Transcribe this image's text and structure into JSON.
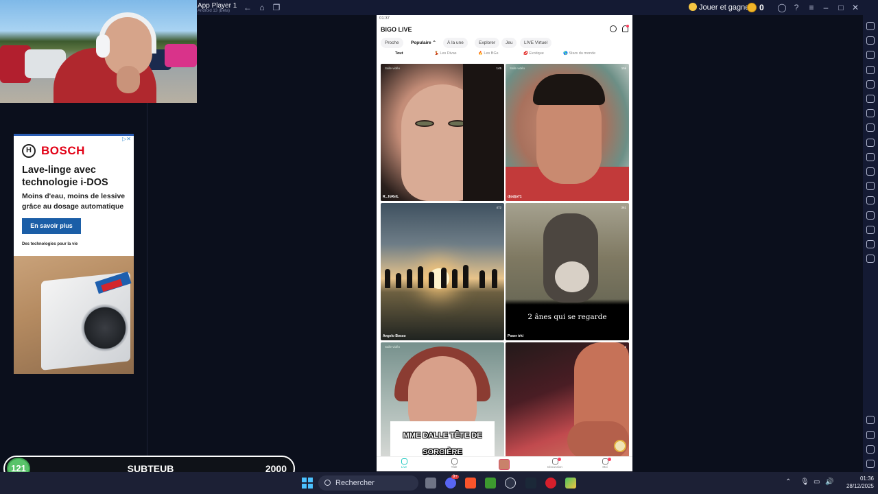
{
  "titlebar": {
    "app_title": "App Player 1",
    "app_subtitle": "Android 13 (Beta)",
    "jouer_label": "Jouer et gagner",
    "coin_count": "0"
  },
  "ad": {
    "brand": "BOSCH",
    "headline": "Lave-linge avec technologie i-DOS",
    "description": "Moins d'eau, moins de lessive grâce au dosage automatique",
    "cta": "En savoir plus",
    "tagline": "Des technologies pour la vie"
  },
  "sub_bar": {
    "level": "121",
    "name": "SUBTEUB",
    "goal": "2000"
  },
  "phone": {
    "status_time": "01:37",
    "brand": "BIGO LIVE",
    "tabs": [
      "Proche",
      "Populaire ⌃",
      "À la une",
      "Explorer",
      "Jeu",
      "LIVE Virtuel"
    ],
    "subtabs": [
      "Tout",
      "Les Divas",
      "Les BGs",
      "Exotique",
      "Stars du monde"
    ],
    "tiles": [
      {
        "badge": "Salle vidéo",
        "viewers": "145",
        "host": "R...foRelL"
      },
      {
        "badge": "Salle vidéo",
        "viewers": "15k",
        "host": "djodjo71"
      },
      {
        "badge": "",
        "viewers": "472",
        "host": "Angelo Bosso"
      },
      {
        "badge": "",
        "viewers": "361",
        "host": "Poser trki",
        "caption": "2 ânes qui se regarde"
      },
      {
        "badge": "Salle vidéo",
        "viewers": "",
        "host": "",
        "caption": "MME DALLE TÊTE DE SORCIÈRE"
      },
      {
        "badge": "",
        "viewers": "2",
        "host": ""
      }
    ],
    "bottom_nav": [
      "Live",
      "Tâle",
      "",
      "Discussion",
      "Moi"
    ]
  },
  "taskbar": {
    "search_placeholder": "Rechercher",
    "time": "01:36",
    "date": "28/12/2025",
    "discord_badge": "9+"
  },
  "colors": {
    "emulator_bg": "#141a33",
    "bigo_accent": "#1ec8c0",
    "bosch_red": "#e20015",
    "bosch_blue": "#1b5ea7",
    "level_green": "#59c36a"
  }
}
